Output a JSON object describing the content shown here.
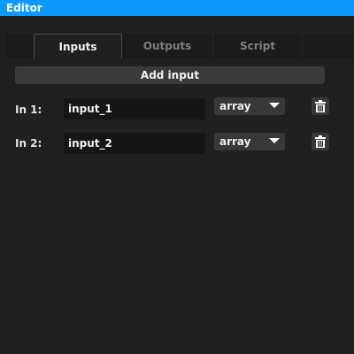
{
  "window": {
    "title": "Editor"
  },
  "tabs": [
    {
      "label": "Inputs",
      "active": true
    },
    {
      "label": "Outputs",
      "active": false
    },
    {
      "label": "Script",
      "active": false
    }
  ],
  "inputs_panel": {
    "add_button_label": "Add input",
    "rows": [
      {
        "label": "In 1:",
        "name_value": "input_1",
        "type_value": "array",
        "delete_icon": "trash-icon"
      },
      {
        "label": "In 2:",
        "name_value": "input_2",
        "type_value": "array",
        "delete_icon": "trash-icon"
      }
    ]
  },
  "colors": {
    "accent": "#0d99ff",
    "background": "#202020",
    "control": "#383838",
    "field": "#161616"
  }
}
